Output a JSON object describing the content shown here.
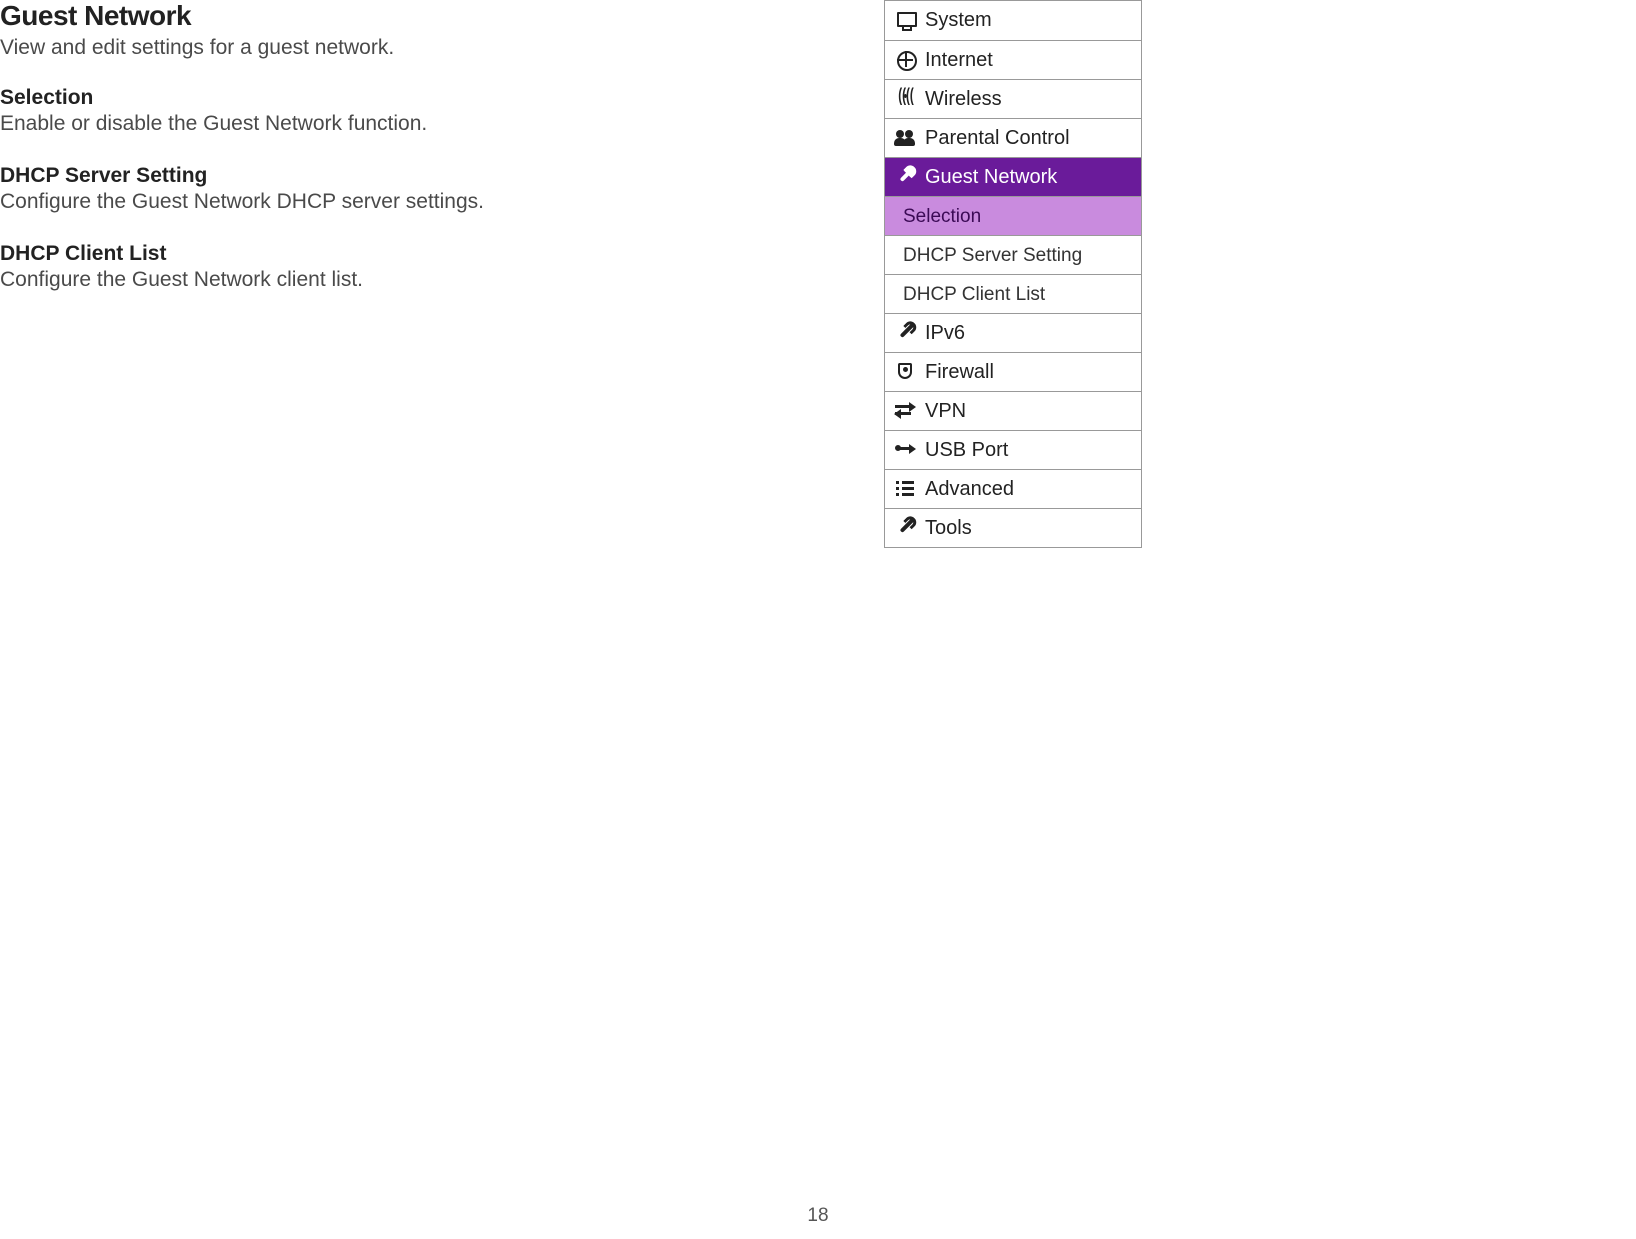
{
  "main": {
    "title": "Guest Network",
    "description": "View and edit settings for a guest network.",
    "sections": [
      {
        "title": "Selection",
        "desc": "Enable or disable the Guest Network function."
      },
      {
        "title": "DHCP Server Setting",
        "desc": "Configure the Guest Network DHCP server settings."
      },
      {
        "title": "DHCP Client List",
        "desc": "Configure the Guest Network client list."
      }
    ]
  },
  "menu": {
    "items": [
      {
        "label": "System",
        "icon": "monitor"
      },
      {
        "label": "Internet",
        "icon": "globe"
      },
      {
        "label": "Wireless",
        "icon": "wifi"
      },
      {
        "label": "Parental Control",
        "icon": "users"
      },
      {
        "label": "Guest Network",
        "icon": "wrench",
        "active": true,
        "sub": [
          {
            "label": "Selection",
            "selected": true
          },
          {
            "label": "DHCP Server Setting"
          },
          {
            "label": "DHCP Client List"
          }
        ]
      },
      {
        "label": "IPv6",
        "icon": "wrench"
      },
      {
        "label": "Firewall",
        "icon": "shield"
      },
      {
        "label": "VPN",
        "icon": "vpn"
      },
      {
        "label": "USB Port",
        "icon": "usb"
      },
      {
        "label": "Advanced",
        "icon": "list"
      },
      {
        "label": "Tools",
        "icon": "wrench"
      }
    ]
  },
  "page_number": "18",
  "colors": {
    "brand_purple": "#6a1b9a",
    "highlight_purple": "#c98bde"
  }
}
